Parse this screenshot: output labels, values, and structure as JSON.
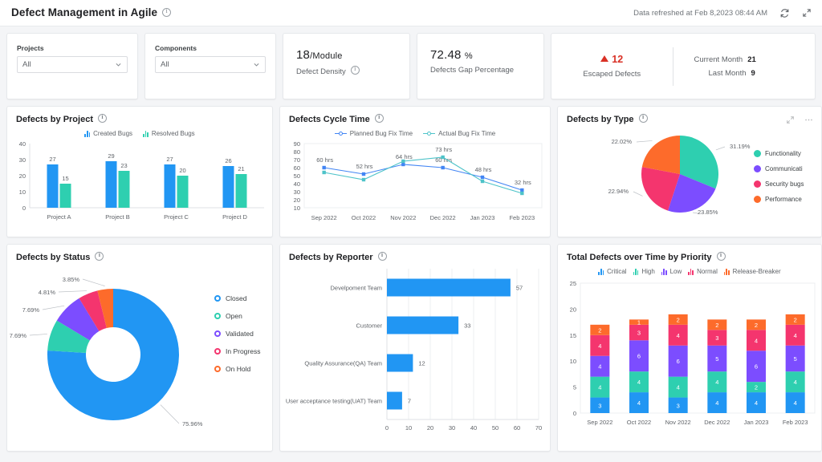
{
  "header": {
    "title": "Defect Management in Agile",
    "info_icon": "info-circle-icon",
    "refresh_text": "Data refreshed at Feb 8,2023 08:44 AM",
    "refresh_icon": "refresh-icon",
    "collapse_icon": "collapse-arrows-icon"
  },
  "filters": [
    {
      "label": "Projects",
      "value": "All",
      "placeholder": "All"
    },
    {
      "label": "Components",
      "value": "All",
      "placeholder": "All"
    }
  ],
  "kpis": {
    "defect_density": {
      "value": "18",
      "unit": "/Module",
      "label": "Defect Density"
    },
    "defects_gap": {
      "value": "72.48",
      "unit": "%",
      "label": "Defects Gap Percentage"
    },
    "escaped": {
      "value": "12",
      "label": "Escaped Defects",
      "trend": "up",
      "trend_color": "#d93025",
      "current_month_label": "Current Month",
      "current_month_value": "21",
      "last_month_label": "Last Month",
      "last_month_value": "9"
    }
  },
  "chart_data": [
    {
      "id": "defects-by-project",
      "type": "bar",
      "title": "Defects by Project",
      "categories": [
        "Project A",
        "Project B",
        "Project C",
        "Project D"
      ],
      "series": [
        {
          "name": "Created Bugs",
          "color": "#2196f3",
          "values": [
            27,
            29,
            27,
            26
          ]
        },
        {
          "name": "Resolved Bugs",
          "color": "#2ecfb0",
          "values": [
            15,
            23,
            20,
            21
          ]
        }
      ],
      "ylim": [
        0,
        40
      ],
      "yticks": [
        0,
        10,
        20,
        30,
        40
      ],
      "xlabel": "",
      "ylabel": "",
      "legend_position": "top",
      "grid": false
    },
    {
      "id": "defects-cycle-time",
      "type": "line",
      "title": "Defects Cycle Time",
      "categories": [
        "Sep 2022",
        "Oct 2022",
        "Nov 2022",
        "Dec 2022",
        "Jan 2023",
        "Feb 2023"
      ],
      "series": [
        {
          "name": "Planned Bug Fix Time",
          "color": "#4285f4",
          "values": [
            60,
            52,
            64,
            60,
            48,
            32
          ],
          "labels": [
            "60 hrs",
            "52 hrs",
            "64 hrs",
            "60 hrs",
            "48 hrs",
            "32 hrs"
          ]
        },
        {
          "name": "Actual Bug Fix Time",
          "color": "#4ec3c9",
          "values": [
            54,
            45,
            68,
            73,
            43,
            28
          ],
          "labels": [
            "",
            "",
            "",
            "73 hrs",
            "",
            ""
          ]
        }
      ],
      "ylim": [
        10,
        90
      ],
      "yticks": [
        10,
        20,
        30,
        40,
        50,
        60,
        70,
        80,
        90
      ],
      "legend_position": "top",
      "grid": false
    },
    {
      "id": "defects-by-type",
      "type": "pie",
      "title": "Defects by Type",
      "labels": [
        "Functionality bugs",
        "Communication bugs",
        "Security bugs",
        "Performance bugs"
      ],
      "legend_labels": [
        "Functionality",
        "Communicati",
        "Security bugs",
        "Performance"
      ],
      "values": [
        31.19,
        23.85,
        22.94,
        22.02
      ],
      "value_labels": [
        "31.19%",
        "23.85%",
        "22.94%",
        "22.02%"
      ],
      "colors": [
        "#2ecfb0",
        "#7c4dff",
        "#f4356e",
        "#fd6b2b"
      ],
      "legend_position": "right",
      "tools": [
        "expand-icon",
        "more-options-icon"
      ]
    },
    {
      "id": "defects-by-status",
      "type": "pie",
      "title": "Defects by Status",
      "donut": true,
      "labels": [
        "Closed",
        "Open",
        "Validated",
        "In Progress",
        "On Hold"
      ],
      "values": [
        75.96,
        7.69,
        7.69,
        4.81,
        3.85
      ],
      "value_labels": [
        "75.96%",
        "7.69%",
        "7.69%",
        "4.81%",
        "3.85%"
      ],
      "colors": [
        "#2196f3",
        "#2ecfb0",
        "#7c4dff",
        "#f4356e",
        "#fd6b2b"
      ],
      "legend_position": "right"
    },
    {
      "id": "defects-by-reporter",
      "type": "bar",
      "orientation": "horizontal",
      "title": "Defects by Reporter",
      "categories": [
        "Develpoment Team",
        "Customer",
        "Quality Assurance(QA) Team",
        "User acceptance testing(UAT) Team"
      ],
      "values": [
        57,
        33,
        12,
        7
      ],
      "color": "#2196f3",
      "xlim": [
        0,
        70
      ],
      "xticks": [
        0,
        10,
        20,
        30,
        40,
        50,
        60,
        70
      ],
      "grid": true
    },
    {
      "id": "total-defects-over-time-by-priority",
      "type": "bar",
      "stacked": true,
      "title": "Total Defects over Time by Priority",
      "categories": [
        "Sep 2022",
        "Oct 2022",
        "Nov 2022",
        "Dec 2022",
        "Jan 2023",
        "Feb 2023"
      ],
      "series": [
        {
          "name": "Critical",
          "color": "#2196f3",
          "values": [
            3,
            4,
            3,
            4,
            4,
            4
          ]
        },
        {
          "name": "High",
          "color": "#2ecfb0",
          "values": [
            4,
            4,
            4,
            4,
            2,
            4
          ]
        },
        {
          "name": "Low",
          "color": "#7c4dff",
          "values": [
            4,
            6,
            6,
            5,
            6,
            5
          ]
        },
        {
          "name": "Normal",
          "color": "#f4356e",
          "values": [
            4,
            3,
            4,
            3,
            4,
            4
          ]
        },
        {
          "name": "Release-Breaker",
          "color": "#fd6b2b",
          "values": [
            2,
            1,
            2,
            2,
            2,
            2
          ]
        }
      ],
      "ylim": [
        0,
        25
      ],
      "yticks": [
        0,
        5,
        10,
        15,
        20,
        25
      ],
      "legend_position": "top"
    }
  ]
}
